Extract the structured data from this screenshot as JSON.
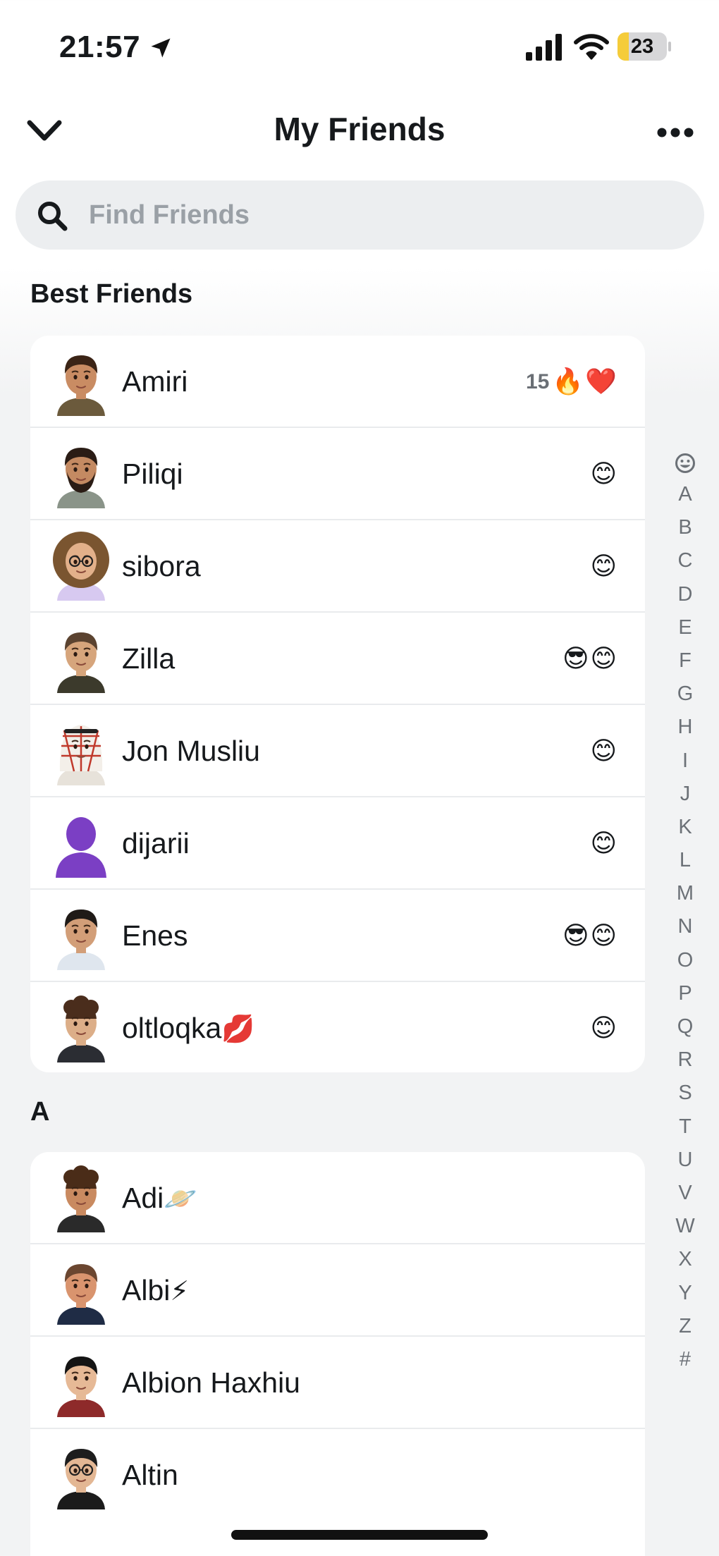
{
  "status_bar": {
    "time": "21:57",
    "battery": "23",
    "battery_level_percent": 23
  },
  "header": {
    "title": "My Friends"
  },
  "search": {
    "placeholder": "Find Friends"
  },
  "sections": {
    "best_friends": "Best Friends",
    "a": "A"
  },
  "best_friends": [
    {
      "name": "Amiri",
      "streak": "15",
      "emojis": [
        "🔥",
        "❤️"
      ],
      "avatar": "brown-hair-avatar"
    },
    {
      "name": "Piliqi",
      "streak": "",
      "emojis": [
        "😊"
      ],
      "avatar": "bearded-avatar"
    },
    {
      "name": "sibora",
      "streak": "",
      "emojis": [
        "😊"
      ],
      "avatar": "curly-hair-glasses-avatar"
    },
    {
      "name": "Zilla",
      "streak": "",
      "emojis": [
        "😎",
        "😊"
      ],
      "avatar": "short-hair-avatar"
    },
    {
      "name": "Jon Musliu",
      "streak": "",
      "emojis": [
        "😊"
      ],
      "avatar": "keffiyeh-avatar"
    },
    {
      "name": "dijarii",
      "streak": "",
      "emojis": [
        "😊"
      ],
      "avatar": "purple-silhouette-avatar"
    },
    {
      "name": "Enes",
      "streak": "",
      "emojis": [
        "😎",
        "😊"
      ],
      "avatar": "dark-hair-avatar"
    },
    {
      "name": "oltloqka",
      "name_emoji": "💋",
      "streak": "",
      "emojis": [
        "😊"
      ],
      "avatar": "curly-top-avatar"
    }
  ],
  "a_friends": [
    {
      "name": "Adi",
      "name_emoji": "🪐",
      "avatar": "curly-brown-avatar"
    },
    {
      "name": "Albi",
      "name_emoji": "⚡",
      "avatar": "buzzcut-avatar"
    },
    {
      "name": "Albion Haxhiu",
      "name_emoji": "",
      "avatar": "black-hair-avatar"
    },
    {
      "name": "Altin",
      "name_emoji": "",
      "avatar": "glasses-avatar"
    }
  ],
  "alpha_index": [
    "A",
    "B",
    "C",
    "D",
    "E",
    "F",
    "G",
    "H",
    "I",
    "J",
    "K",
    "L",
    "M",
    "N",
    "O",
    "P",
    "Q",
    "R",
    "S",
    "T",
    "U",
    "V",
    "W",
    "X",
    "Y",
    "Z",
    "#"
  ],
  "colors": {
    "accent_purple": "#7b3fc4",
    "text": "#16191c",
    "muted": "#6c7177"
  }
}
